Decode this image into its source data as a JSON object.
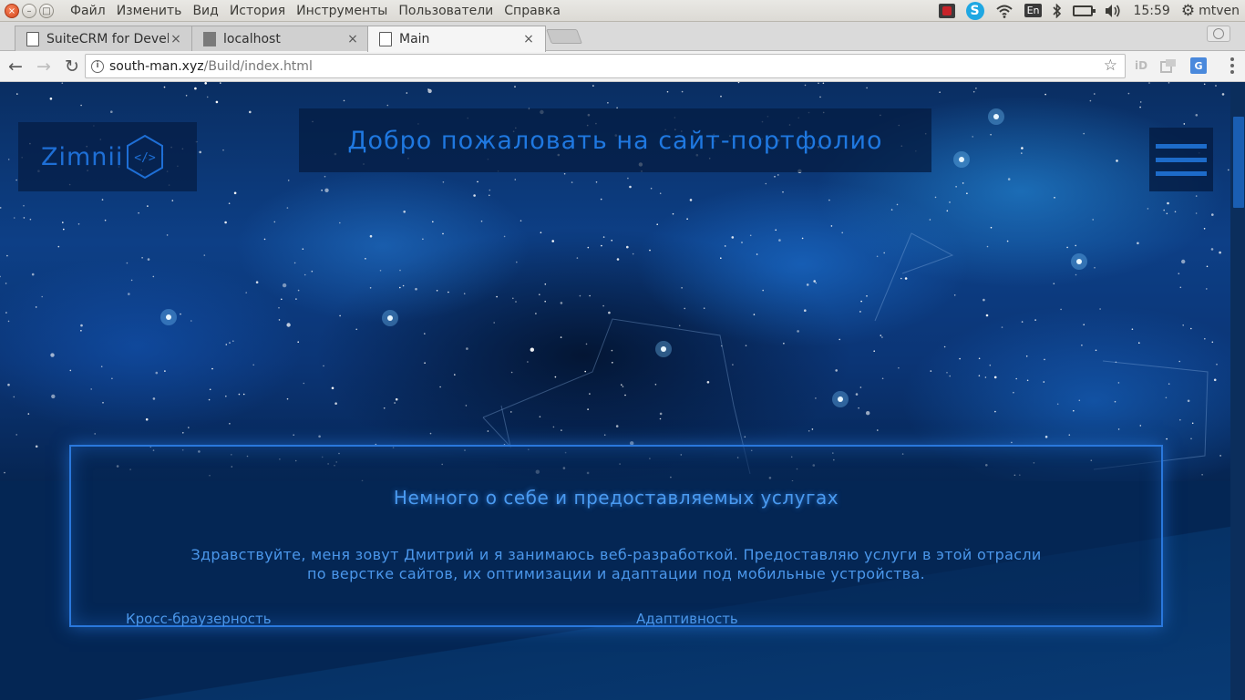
{
  "os": {
    "menu": [
      "Файл",
      "Изменить",
      "Вид",
      "История",
      "Инструменты",
      "Пользователи",
      "Справка"
    ],
    "lang": "En",
    "time": "15:59",
    "user": "mtven",
    "icons": [
      "record-icon",
      "skype-icon",
      "wifi-icon",
      "keyboard-language-icon",
      "bluetooth-icon",
      "battery-icon",
      "volume-icon",
      "gear-icon"
    ]
  },
  "browser": {
    "tabs": [
      {
        "title": "SuiteCRM for Devel",
        "icon": "document-icon",
        "active": false
      },
      {
        "title": "localhost",
        "icon": "square-icon",
        "active": false
      },
      {
        "title": "Main",
        "icon": "document-icon",
        "active": true
      }
    ],
    "url_host": "south-man.xyz",
    "url_path": "/Build/index.html"
  },
  "page": {
    "logo_text": "Zimnii",
    "logo_code": "</>",
    "welcome": "Добро пожаловать на сайт-портфолио",
    "about": {
      "title": "Немного о себе и предоставляемых услугах",
      "text_line1": "Здравствуйте, меня зовут Дмитрий и я занимаюсь веб-разработкой. Предоставляю услуги в этой отрасли",
      "text_line2": "по верстке сайтов, их оптимизации и адаптации под мобильные устройства.",
      "col_left": "Кросс-браузерность",
      "col_right": "Адаптивность"
    }
  },
  "colors": {
    "accent": "#1f78e0",
    "page_bg": "#03214a",
    "card_border": "#2a78dc"
  }
}
